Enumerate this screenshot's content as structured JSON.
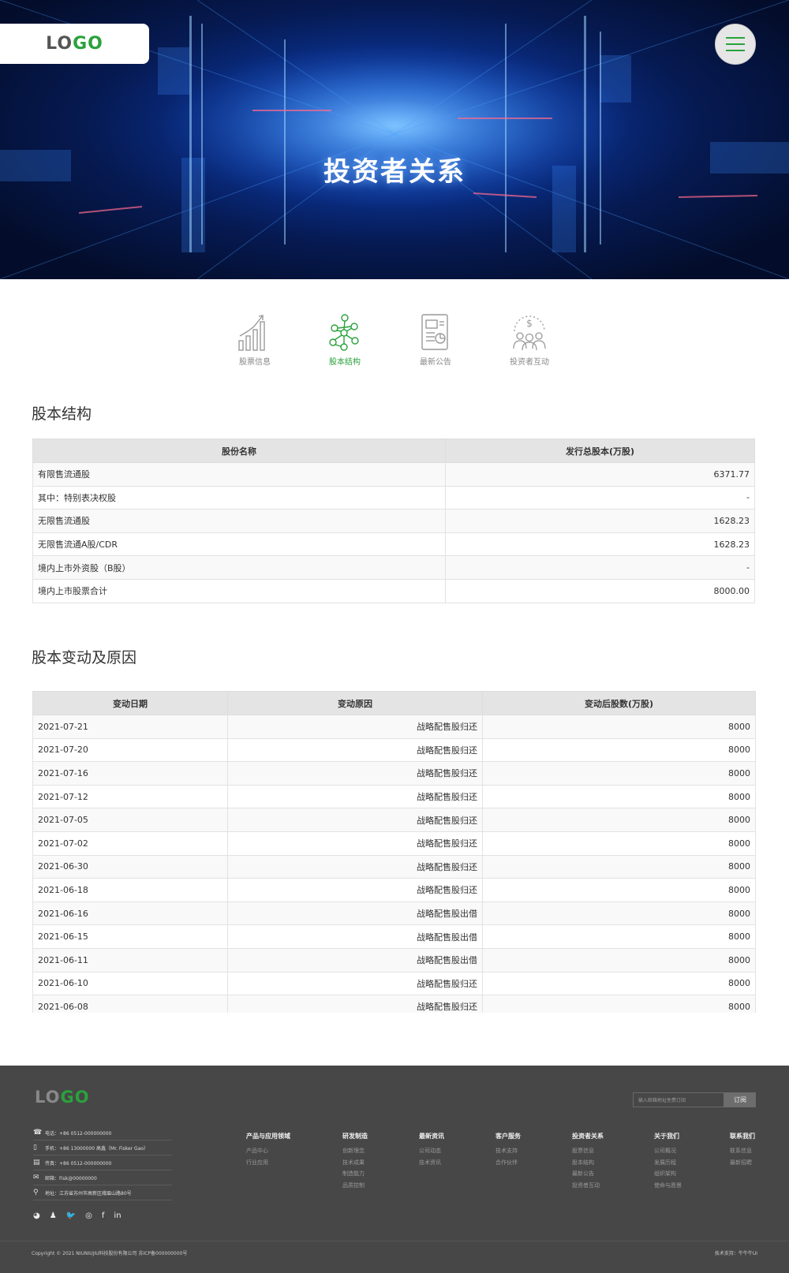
{
  "header": {
    "logo_lo": "LO",
    "logo_go": "GO",
    "hero_title": "投资者关系"
  },
  "tabs": [
    {
      "label": "股票信息",
      "icon": "rising-chart-icon",
      "active": false
    },
    {
      "label": "股本结构",
      "icon": "network-structure-icon",
      "active": true
    },
    {
      "label": "最新公告",
      "icon": "report-document-icon",
      "active": false
    },
    {
      "label": "投资者互动",
      "icon": "investors-group-icon",
      "active": false
    }
  ],
  "share_structure": {
    "title": "股本结构",
    "headers": [
      "股份名称",
      "发行总股本(万股)"
    ],
    "rows": [
      [
        "有限售流通股",
        "6371.77"
      ],
      [
        "其中：特别表决权股",
        "-"
      ],
      [
        "无限售流通股",
        "1628.23"
      ],
      [
        "无限售流通A股/CDR",
        "1628.23"
      ],
      [
        "境内上市外资股（B股）",
        "-"
      ],
      [
        "境内上市股票合计",
        "8000.00"
      ]
    ]
  },
  "share_changes": {
    "title": "股本变动及原因",
    "headers": [
      "变动日期",
      "变动原因",
      "变动后股数(万股)"
    ],
    "rows": [
      [
        "2021-07-21",
        "战略配售股归还",
        "8000"
      ],
      [
        "2021-07-20",
        "战略配售股归还",
        "8000"
      ],
      [
        "2021-07-16",
        "战略配售股归还",
        "8000"
      ],
      [
        "2021-07-12",
        "战略配售股归还",
        "8000"
      ],
      [
        "2021-07-05",
        "战略配售股归还",
        "8000"
      ],
      [
        "2021-07-02",
        "战略配售股归还",
        "8000"
      ],
      [
        "2021-06-30",
        "战略配售股归还",
        "8000"
      ],
      [
        "2021-06-18",
        "战略配售股归还",
        "8000"
      ],
      [
        "2021-06-16",
        "战略配售股出借",
        "8000"
      ],
      [
        "2021-06-15",
        "战略配售股出借",
        "8000"
      ],
      [
        "2021-06-11",
        "战略配售股出借",
        "8000"
      ],
      [
        "2021-06-10",
        "战略配售股归还",
        "8000"
      ],
      [
        "2021-06-08",
        "战略配售股归还",
        "8000"
      ]
    ]
  },
  "footer": {
    "logo_lo": "LO",
    "logo_go": "GO",
    "subscribe_placeholder": "输入邮箱地址免费订阅",
    "subscribe_button": "订阅",
    "contacts": [
      {
        "icon": "phone-icon",
        "text": "电话：+86 0512-000000000"
      },
      {
        "icon": "mobile-icon",
        "text": "手机：+86 13000000  高鑫（Mr. Fisker Gao）"
      },
      {
        "icon": "fax-icon",
        "text": "传真：+86 0512-000000000"
      },
      {
        "icon": "mail-icon",
        "text": "邮箱：Fisk@00000000"
      },
      {
        "icon": "location-icon",
        "text": "地址：江苏省苏州市高新区峨眉山路80号"
      }
    ],
    "socials": [
      "wechat-icon",
      "qq-icon",
      "twitter-icon",
      "instagram-icon",
      "facebook-icon",
      "linkedin-icon"
    ],
    "columns": [
      {
        "title": "产品与应用领域",
        "items": [
          "产品中心",
          "行业应用"
        ]
      },
      {
        "title": "研发制造",
        "items": [
          "创新理念",
          "技术成果",
          "制造能力",
          "品质控制"
        ]
      },
      {
        "title": "最新资讯",
        "items": [
          "公司动态",
          "技术资讯"
        ]
      },
      {
        "title": "客户服务",
        "items": [
          "技术支持",
          "合作伙伴"
        ]
      },
      {
        "title": "投资者关系",
        "items": [
          "股票信息",
          "股本结构",
          "最新公告",
          "投资者互动"
        ]
      },
      {
        "title": "关于我们",
        "items": [
          "公司概况",
          "发展历程",
          "组织架构",
          "使命与愿景"
        ]
      },
      {
        "title": "联系我们",
        "items": [
          "联系信息",
          "最新招聘"
        ]
      }
    ],
    "copyright": "Copyright © 2021 NIUNIUJIU科技股份有限公司  苏ICP备000000000号",
    "tech_support": "技术支持：牛牛牛UI"
  },
  "colors": {
    "accent": "#2aa13c",
    "footer_bg": "#474747"
  }
}
